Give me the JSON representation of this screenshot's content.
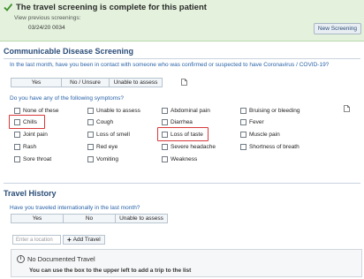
{
  "banner": {
    "title": "The travel screening is complete for this patient",
    "prev_label": "View previous screenings:",
    "prev_date": "03/24/20 0034",
    "new_screening_label": "New Screening"
  },
  "disease": {
    "section_title": "Communicable Disease Screening",
    "contact_question": "In the last month, have you been in contact with someone who was confirmed or suspected to have Coronavirus / COVID-19?",
    "contact_options": [
      "Yes",
      "No / Unsure",
      "Unable to assess"
    ],
    "symptom_question": "Do you have any of the following symptoms?",
    "symptoms": [
      [
        "None of these",
        "Unable to assess",
        "Abdominal pain",
        "Bruising or bleeding"
      ],
      [
        "Chills",
        "Cough",
        "Diarrhea",
        "Fever"
      ],
      [
        "Joint pain",
        "Loss of smell",
        "Loss of taste",
        "Muscle pain"
      ],
      [
        "Rash",
        "Red eye",
        "Severe headache",
        "Shortness of breath"
      ],
      [
        "Sore throat",
        "Vomiting",
        "Weakness",
        ""
      ]
    ],
    "highlighted": [
      "Chills",
      "Loss of taste"
    ]
  },
  "travel": {
    "section_title": "Travel History",
    "question": "Have you traveled internationally in the last month?",
    "options": [
      "Yes",
      "No",
      "Unable to assess"
    ],
    "location_placeholder": "Enter a location",
    "add_travel_label": "Add Travel",
    "add_icon": "+",
    "empty_title": "No Documented Travel",
    "empty_hint": "You can use the box to the upper left to add a trip to the list",
    "info_icon": "i"
  },
  "colors": {
    "banner_bg": "#e4f2dd",
    "question_text": "#2a63a8",
    "section_title": "#2b4d78",
    "highlight": "#d9383a"
  }
}
